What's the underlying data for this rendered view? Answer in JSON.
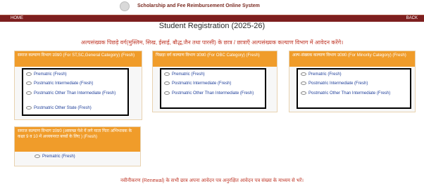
{
  "header": {
    "system_title": "Scholarship and Fee Reimbursement Online System"
  },
  "nav": {
    "home": "HOME",
    "back": "BACK"
  },
  "main": {
    "title": "Student Registration (2025-26)",
    "notice": "अल्पसंख्यक पिछड़े वर्ग(मुस्लिम, सिख, ईसाई, बौद्ध,जैन तथा पारसी) के छात्र / छात्राएँ अल्पसंख्यक कल्याण विभाग में आवेदन करेंगे।",
    "footer_note": "नवीनीकरण (Renewal) के सभी छात्र अपना आवेदन पत्र अनुरक्षित आवेदन पत्र संख्या के माध्यम से भरें।"
  },
  "cards": [
    {
      "heading": "समाज कल्याण विभाग उ0प्र0 (For ST,SC,General Category) (Fresh)",
      "options": [
        "Prematric (Fresh)",
        "Postmatric Intermediate (Fresh)",
        "Postmatric Other Than Intermediate (Fresh)",
        "Postmatric Other State (Fresh)"
      ]
    },
    {
      "heading": "पिछड़ा वर्ग कल्याण विभाग उ0प्र0 (For OBC Category) (Fresh)",
      "options": [
        "Prematric (Fresh)",
        "Postmatric Intermediate (Fresh)",
        "Postmatric Other Than Intermediate (Fresh)"
      ]
    },
    {
      "heading": "अल्प-संख्यक कल्याण विभाग उ0प्र0 (For Minority Category) (Fresh)",
      "options": [
        "Prematric (Fresh)",
        "Postmatric Intermediate (Fresh)",
        "Postmatric Other Than Intermediate (Fresh)"
      ]
    },
    {
      "heading": "समाज कल्याण विभाग उ0प्र0 (अस्वच्छ पेशे में लगे माता पिता अभिभावक के कक्षा 9 व 10 में अध्ययनरत बच्चों के लिए ) (Fresh)",
      "options": [
        "Prematric (Fresh)"
      ]
    }
  ]
}
